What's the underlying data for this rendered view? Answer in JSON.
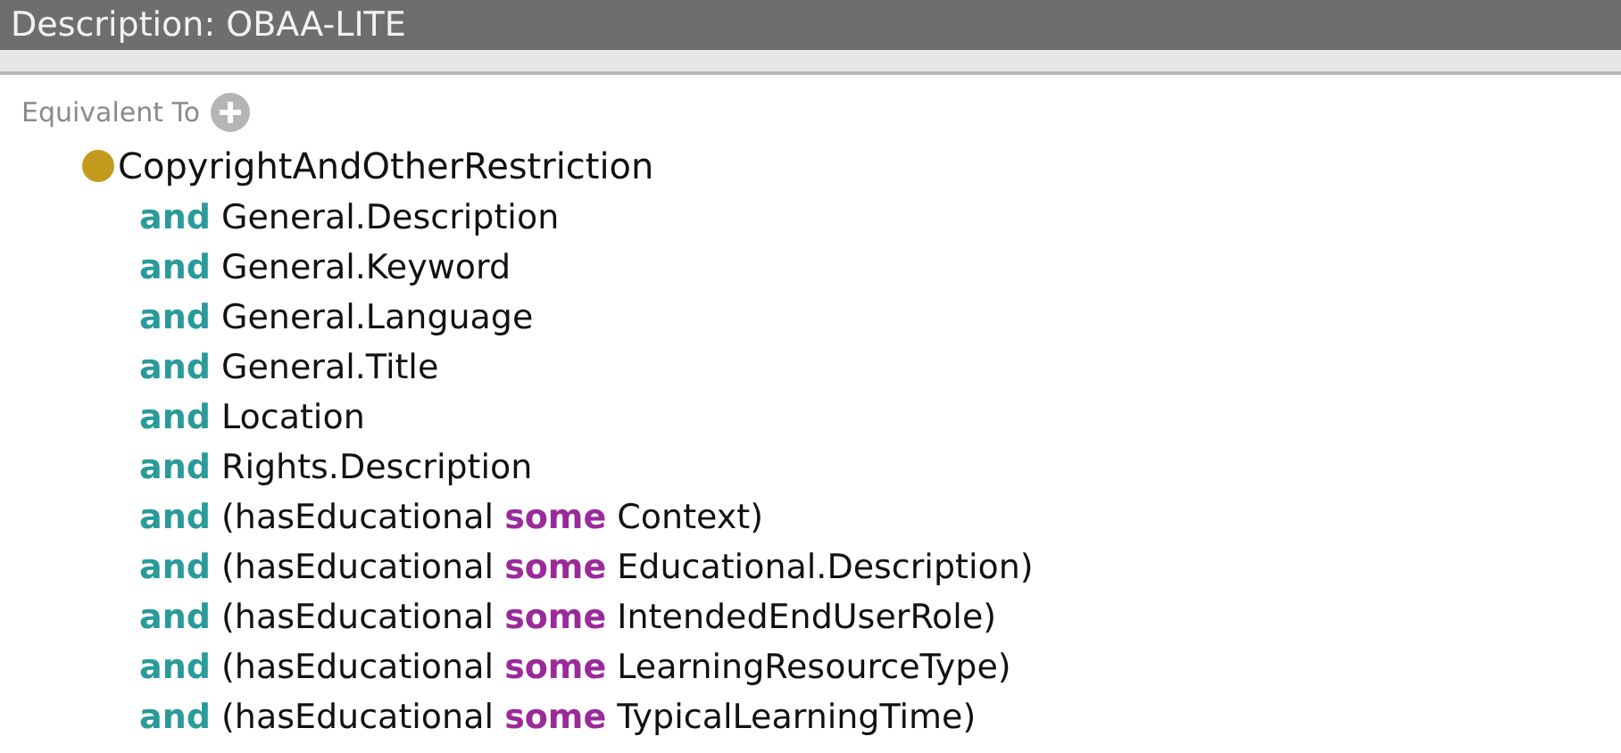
{
  "title": "Description: OBAA-LITE",
  "section": {
    "label": "Equivalent To"
  },
  "expression": {
    "class": "CopyrightAndOtherRestriction",
    "lines": [
      [
        {
          "kind": "and",
          "text": "and"
        },
        {
          "kind": "text",
          "text": "General.Description"
        }
      ],
      [
        {
          "kind": "and",
          "text": "and"
        },
        {
          "kind": "text",
          "text": "General.Keyword"
        }
      ],
      [
        {
          "kind": "and",
          "text": "and"
        },
        {
          "kind": "text",
          "text": "General.Language"
        }
      ],
      [
        {
          "kind": "and",
          "text": "and"
        },
        {
          "kind": "text",
          "text": "General.Title"
        }
      ],
      [
        {
          "kind": "and",
          "text": "and"
        },
        {
          "kind": "text",
          "text": "Location"
        }
      ],
      [
        {
          "kind": "and",
          "text": "and"
        },
        {
          "kind": "text",
          "text": "Rights.Description"
        }
      ],
      [
        {
          "kind": "and",
          "text": "and"
        },
        {
          "kind": "text",
          "text": "(hasEducational"
        },
        {
          "kind": "some",
          "text": "some"
        },
        {
          "kind": "text",
          "text": "Context)"
        }
      ],
      [
        {
          "kind": "and",
          "text": "and"
        },
        {
          "kind": "text",
          "text": "(hasEducational"
        },
        {
          "kind": "some",
          "text": "some"
        },
        {
          "kind": "text",
          "text": "Educational.Description)"
        }
      ],
      [
        {
          "kind": "and",
          "text": "and"
        },
        {
          "kind": "text",
          "text": "(hasEducational"
        },
        {
          "kind": "some",
          "text": "some"
        },
        {
          "kind": "text",
          "text": "IntendedEndUserRole)"
        }
      ],
      [
        {
          "kind": "and",
          "text": "and"
        },
        {
          "kind": "text",
          "text": "(hasEducational"
        },
        {
          "kind": "some",
          "text": "some"
        },
        {
          "kind": "text",
          "text": "LearningResourceType)"
        }
      ],
      [
        {
          "kind": "and",
          "text": "and"
        },
        {
          "kind": "text",
          "text": "(hasEducational"
        },
        {
          "kind": "some",
          "text": "some"
        },
        {
          "kind": "text",
          "text": "TypicalLearningTime)"
        }
      ]
    ]
  }
}
